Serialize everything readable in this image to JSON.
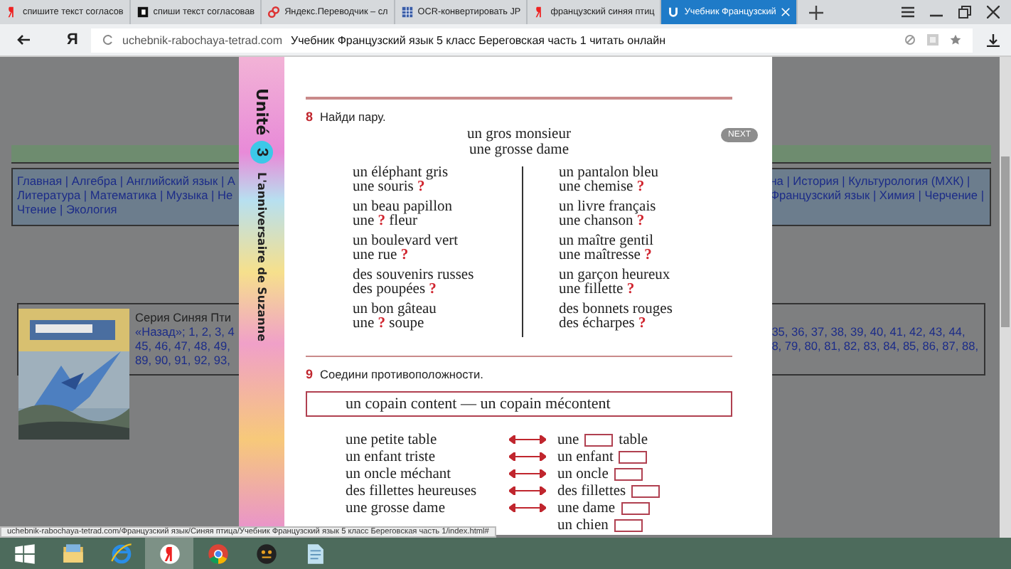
{
  "browser": {
    "tabs": [
      {
        "kind": "yandex",
        "title": "спишите текст согласов",
        "selected": false
      },
      {
        "kind": "square",
        "title": "спиши текст согласовав",
        "selected": false
      },
      {
        "kind": "link",
        "title": "Яндекс.Переводчик – сл",
        "selected": false
      },
      {
        "kind": "grid",
        "title": "OCR-конвертировать JP",
        "selected": false
      },
      {
        "kind": "yandex",
        "title": "французский синяя птиц",
        "selected": false
      },
      {
        "kind": "u",
        "title": "Учебник Французский",
        "selected": true
      }
    ],
    "logo": "Я",
    "address_bar": {
      "domain": "uchebnik-rabochaya-tetrad.com",
      "title": "Учебник Французский язык 5 класс Береговская часть 1 читать онлайн"
    }
  },
  "page": {
    "nav_left": [
      "Главная | Алгебра | Английский язык | А",
      "Литература | Математика | Музыка | Не",
      "Чтение | Экология"
    ],
    "nav_right": [
      "на | История | Культурология (МХК) |",
      "Французский язык | Химия | Черчение |"
    ],
    "series_title": "Серия Синяя Пти",
    "series_left": [
      "«Назад»; 1, 2, 3, 4",
      "45, 46, 47, 48, 49,",
      "89, 90, 91, 92, 93,"
    ],
    "series_right": [
      "35, 36, 37, 38, 39, 40, 41, 42, 43, 44,",
      "8, 79, 80, 81, 82, 83, 84, 85, 86, 87, 88,"
    ]
  },
  "book": {
    "unit": "Unité",
    "unit_number": "3",
    "chapter": "L'anniversaire de Suzanne",
    "next_button": "NEXT",
    "exercise_8": {
      "number": "8",
      "instruction": "Найди пару.",
      "example": [
        "un gros monsieur",
        "une grosse dame"
      ],
      "pairs": [
        [
          {
            "first": "un éléphant gris",
            "second": "une souris",
            "mark": "?"
          },
          {
            "first": "un beau papillon",
            "second": "une",
            "mark": "?",
            "after": "fleur"
          },
          {
            "first": "un boulevard vert",
            "second": "une rue",
            "mark": "?"
          },
          {
            "first": "des souvenirs russes",
            "second": "des poupées",
            "mark": "?"
          },
          {
            "first": "un bon gâteau",
            "second": "une",
            "mark": "?",
            "after": "soupe"
          }
        ],
        [
          {
            "first": "un pantalon bleu",
            "second": "une chemise",
            "mark": "?"
          },
          {
            "first": "un livre français",
            "second": "une chanson",
            "mark": "?"
          },
          {
            "first": "un maître gentil",
            "second": "une maîtresse",
            "mark": "?"
          },
          {
            "first": "un garçon heureux",
            "second": "une fillette",
            "mark": "?"
          },
          {
            "first": "des bonnets rouges",
            "second": "des écharpes",
            "mark": "?"
          }
        ]
      ]
    },
    "exercise_9": {
      "number": "9",
      "instruction": "Соедини противоположности.",
      "example": "un copain content — un copain mécontent",
      "rows": [
        {
          "left": "une petite table",
          "right": "une",
          "after": "table"
        },
        {
          "left": "un enfant triste",
          "right": "un enfant"
        },
        {
          "left": "un oncle méchant",
          "right": "un oncle"
        },
        {
          "left": "des fillettes heureuses",
          "right": "des fillettes"
        },
        {
          "left": "une grosse dame",
          "right": "une dame"
        },
        {
          "right": "un chien"
        }
      ]
    }
  },
  "status_url": "uchebnik-rabochaya-tetrad.com/Французский язык/Синяя птица/Учебник Французский язык 5 класс Береговская часть 1/index.html#",
  "taskbar": [
    {
      "kind": "windows",
      "selected": false
    },
    {
      "kind": "folder",
      "selected": false
    },
    {
      "kind": "ie",
      "selected": false
    },
    {
      "kind": "yandex",
      "selected": true
    },
    {
      "kind": "chrome",
      "selected": false
    },
    {
      "kind": "dark",
      "selected": false
    },
    {
      "kind": "document",
      "selected": false
    }
  ]
}
